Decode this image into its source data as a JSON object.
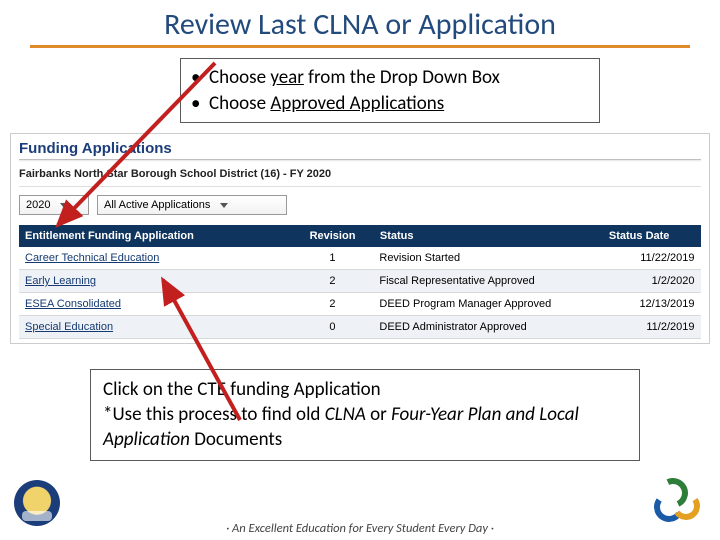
{
  "title": "Review Last CLNA or Application",
  "instructions": {
    "line1_pre": "Choose ",
    "line1_u": "year",
    "line1_post": " from the Drop Down Box",
    "line2_pre": "Choose ",
    "line2_u": "Approved Applications"
  },
  "app": {
    "heading": "Funding Applications",
    "district": "Fairbanks North Star Borough School District (16) - FY 2020",
    "year_value": "2020",
    "filter_value": "All Active Applications",
    "columns": {
      "app": "Entitlement Funding Application",
      "rev": "Revision",
      "status": "Status",
      "date": "Status Date"
    },
    "rows": [
      {
        "app": "Career Technical Education",
        "rev": "1",
        "status": "Revision Started",
        "date": "11/22/2019"
      },
      {
        "app": "Early Learning",
        "rev": "2",
        "status": "Fiscal Representative Approved",
        "date": "1/2/2020"
      },
      {
        "app": "ESEA Consolidated",
        "rev": "2",
        "status": "DEED Program Manager Approved",
        "date": "12/13/2019"
      },
      {
        "app": "Special Education",
        "rev": "0",
        "status": "DEED Administrator Approved",
        "date": "11/2/2019"
      }
    ]
  },
  "note": {
    "line1": "Click on the CTE funding Application",
    "line2_pre": "*Use this process to find old ",
    "line2_em1": "CLNA",
    "line2_mid": " or ",
    "line2_em2": "Four-Year Plan and Local Application",
    "line2_post": " Documents"
  },
  "footer": "· An Excellent Education for Every Student Every Day ·"
}
